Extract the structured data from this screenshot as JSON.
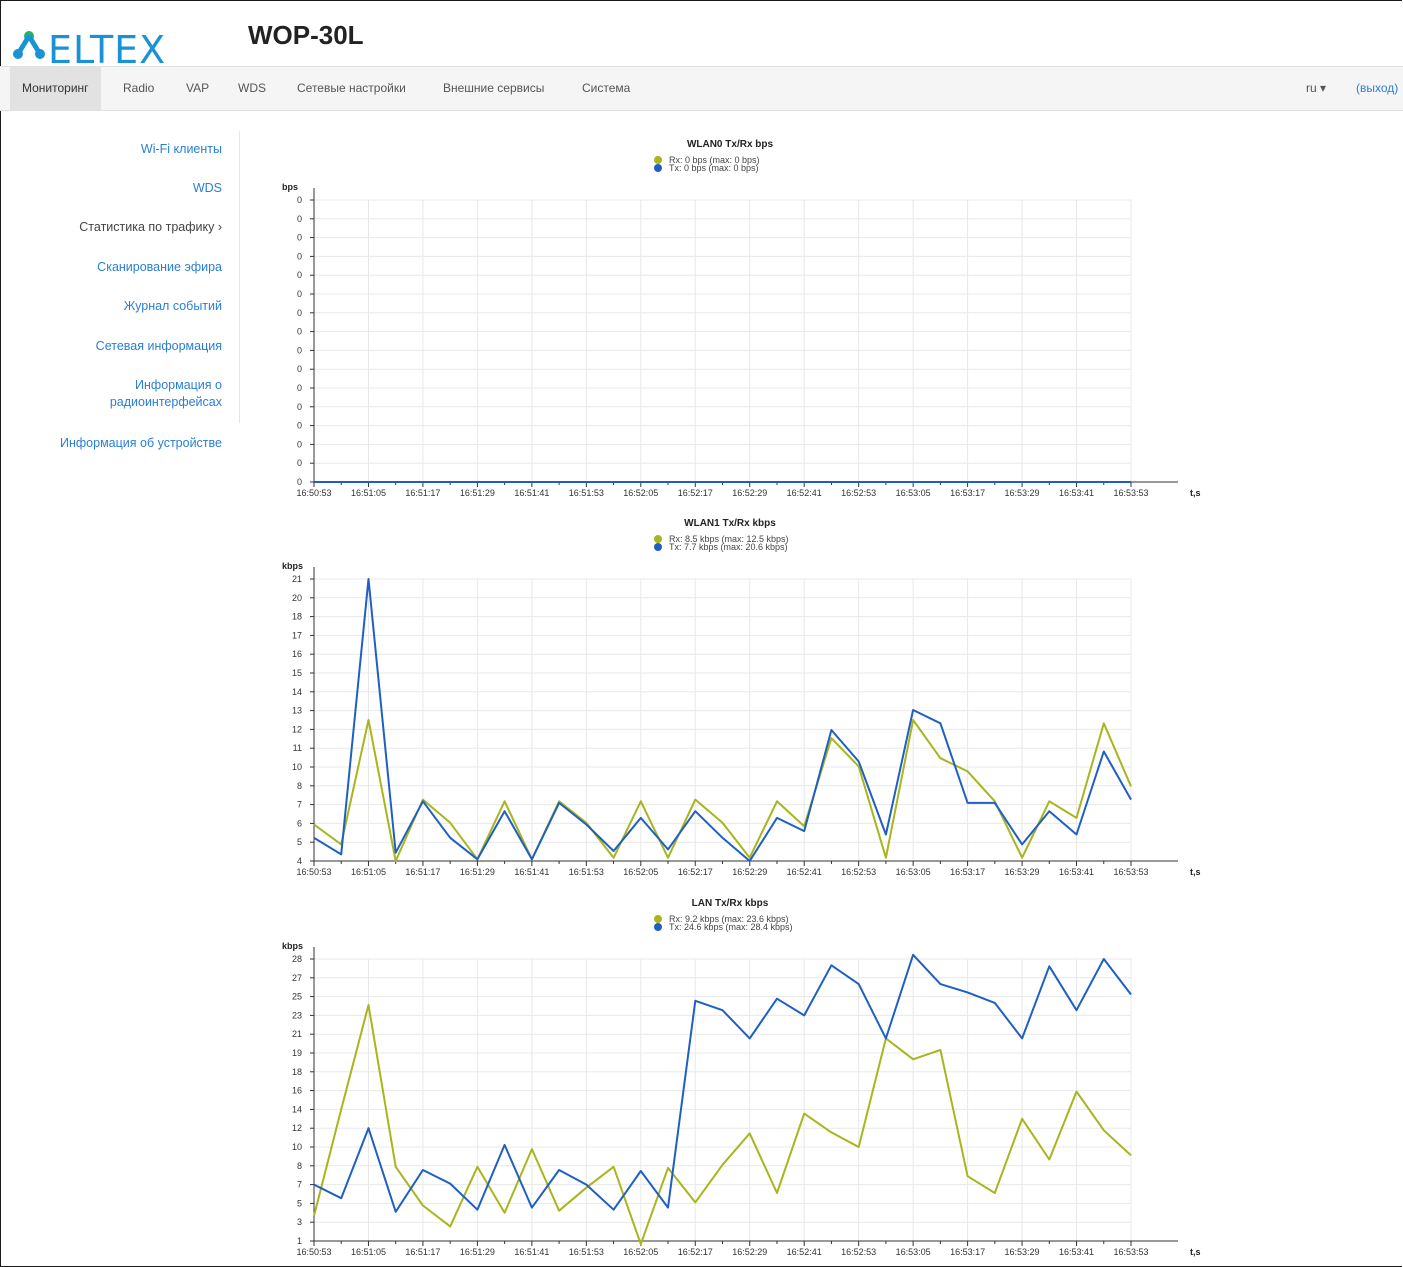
{
  "brand": {
    "logo_text": "ELTEX",
    "model": "WOP-30L"
  },
  "nav": {
    "items": [
      "Мониторинг",
      "Radio",
      "VAP",
      "WDS",
      "Сетевые настройки",
      "Внешние сервисы",
      "Система"
    ],
    "active": "Мониторинг",
    "lang": "ru ▾",
    "logout": "(выход)"
  },
  "sidebar": {
    "items": [
      {
        "label": "Wi-Fi клиенты"
      },
      {
        "label": "WDS"
      },
      {
        "label": "Статистика по трафику ›"
      },
      {
        "label": "Сканирование эфира"
      },
      {
        "label": "Журнал событий"
      },
      {
        "label": "Сетевая информация"
      },
      {
        "label": "Информация о радиоинтерфейсах"
      },
      {
        "label": "Информация об устройстве"
      }
    ]
  },
  "colors": {
    "rx": "#a8b51c",
    "tx": "#1f5fc4",
    "link": "#2a7fd4",
    "grid": "#e8e8e8"
  },
  "chart_data": [
    {
      "type": "line",
      "title": "WLAN0 Tx/Rx bps",
      "ylabel": "bps",
      "xlabel": "t,s",
      "legend": [
        "Rx: 0 bps (max: 0 bps)",
        "Tx: 0 bps (max: 0 bps)"
      ],
      "yticks": [
        0,
        0,
        0,
        0,
        0,
        0,
        0,
        0,
        0,
        0,
        0,
        0,
        0,
        0,
        0,
        0
      ],
      "ylim": [
        0,
        15
      ],
      "x": [
        "16:50:53",
        "",
        "16:51:05",
        "",
        "16:51:17",
        "",
        "16:51:29",
        "",
        "16:51:41",
        "",
        "16:51:53",
        "",
        "16:52:05",
        "",
        "16:52:17",
        "",
        "16:52:29",
        "",
        "16:52:41",
        "",
        "16:52:53",
        "",
        "16:53:05",
        "",
        "16:53:17",
        "",
        "16:53:29",
        "",
        "16:53:41",
        "",
        "16:53:53"
      ],
      "series": [
        {
          "name": "Rx",
          "values": [
            0,
            0,
            0,
            0,
            0,
            0,
            0,
            0,
            0,
            0,
            0,
            0,
            0,
            0,
            0,
            0,
            0,
            0,
            0,
            0,
            0,
            0,
            0,
            0,
            0,
            0,
            0,
            0,
            0,
            0,
            0
          ]
        },
        {
          "name": "Tx",
          "values": [
            0,
            0,
            0,
            0,
            0,
            0,
            0,
            0,
            0,
            0,
            0,
            0,
            0,
            0,
            0,
            0,
            0,
            0,
            0,
            0,
            0,
            0,
            0,
            0,
            0,
            0,
            0,
            0,
            0,
            0,
            0
          ]
        }
      ]
    },
    {
      "type": "line",
      "title": "WLAN1 Tx/Rx kbps",
      "ylabel": "kbps",
      "xlabel": "t,s",
      "legend": [
        "Rx: 8.5 kbps (max: 12.5 kbps)",
        "Tx: 7.7 kbps (max: 20.6 kbps)"
      ],
      "yticks": [
        4,
        5,
        6,
        7,
        8,
        10,
        11,
        12,
        13,
        14,
        15,
        16,
        17,
        18,
        20,
        21
      ],
      "ylim": [
        4,
        21
      ],
      "x": [
        "16:50:53",
        "",
        "16:51:05",
        "",
        "16:51:17",
        "",
        "16:51:29",
        "",
        "16:51:41",
        "",
        "16:51:53",
        "",
        "16:52:05",
        "",
        "16:52:17",
        "",
        "16:52:29",
        "",
        "16:52:41",
        "",
        "16:52:53",
        "",
        "16:53:05",
        "",
        "16:53:17",
        "",
        "16:53:29",
        "",
        "16:53:41",
        "",
        "16:53:53"
      ],
      "series": [
        {
          "name": "Rx",
          "values": [
            6.2,
            5.0,
            12.5,
            4.0,
            7.7,
            6.3,
            4.1,
            7.6,
            4.1,
            7.6,
            6.3,
            4.2,
            7.6,
            4.2,
            7.7,
            6.3,
            4.2,
            7.6,
            6.1,
            11.4,
            9.7,
            4.2,
            12.5,
            10.2,
            9.4,
            7.6,
            4.2,
            7.6,
            6.6,
            12.3,
            8.5
          ]
        },
        {
          "name": "Tx",
          "values": [
            5.4,
            4.4,
            21.0,
            4.5,
            7.6,
            5.4,
            4.1,
            7.0,
            4.1,
            7.5,
            6.2,
            4.6,
            6.6,
            4.7,
            7.0,
            5.4,
            4.0,
            6.6,
            5.8,
            11.9,
            10.0,
            5.6,
            13.1,
            12.3,
            7.5,
            7.5,
            5.0,
            7.0,
            5.6,
            10.6,
            7.7
          ]
        }
      ]
    },
    {
      "type": "line",
      "title": "LAN Tx/Rx kbps",
      "ylabel": "kbps",
      "xlabel": "t,s",
      "legend": [
        "Rx: 9.2 kbps (max: 23.6 kbps)",
        "Tx: 24.6 kbps (max: 28.4 kbps)"
      ],
      "yticks": [
        1,
        3,
        5,
        7,
        8,
        10,
        12,
        14,
        16,
        18,
        19,
        21,
        23,
        25,
        27,
        28
      ],
      "ylim": [
        1,
        28
      ],
      "x": [
        "16:50:53",
        "",
        "16:51:05",
        "",
        "16:51:17",
        "",
        "16:51:29",
        "",
        "16:51:41",
        "",
        "16:51:53",
        "",
        "16:52:05",
        "",
        "16:52:17",
        "",
        "16:52:29",
        "",
        "16:52:41",
        "",
        "16:52:53",
        "",
        "16:53:05",
        "",
        "16:53:17",
        "",
        "16:53:29",
        "",
        "16:53:41",
        "",
        "16:53:53"
      ],
      "series": [
        {
          "name": "Rx",
          "values": [
            3.4,
            13.6,
            23.6,
            8.1,
            4.4,
            2.4,
            8.1,
            3.7,
            9.8,
            3.9,
            6.1,
            8.1,
            0.7,
            8.0,
            4.7,
            8.3,
            11.3,
            5.6,
            13.2,
            11.4,
            10.0,
            20.4,
            18.4,
            19.3,
            7.2,
            5.6,
            12.7,
            8.8,
            15.3,
            11.6,
            9.2
          ]
        },
        {
          "name": "Tx",
          "values": [
            6.4,
            5.1,
            11.8,
            3.8,
            7.8,
            6.5,
            4.0,
            10.2,
            4.2,
            7.8,
            6.4,
            4.0,
            7.7,
            4.2,
            24.0,
            23.1,
            20.4,
            24.2,
            22.6,
            27.4,
            25.6,
            20.4,
            28.4,
            25.6,
            24.8,
            23.8,
            20.4,
            27.3,
            23.1,
            28.0,
            24.6
          ]
        }
      ]
    }
  ]
}
